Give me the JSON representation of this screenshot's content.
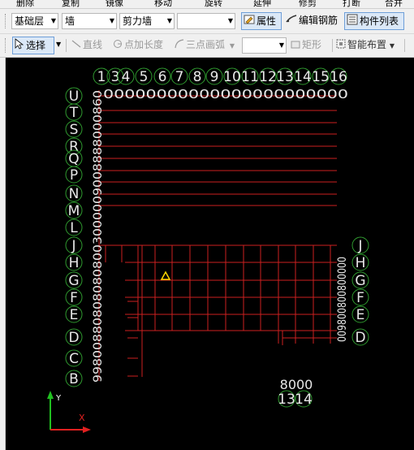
{
  "top_menu": [
    "删除",
    "复制",
    "镜像",
    "移动",
    "旋转",
    "延伸",
    "修剪",
    "打断",
    "合并"
  ],
  "toolbar1": {
    "floor": "基础层",
    "element_type": "墙",
    "element_subtype": "剪力墙",
    "property_label": "属性",
    "edit_rebar_label": "编辑钢筋",
    "component_list_label": "构件列表"
  },
  "toolbar2": {
    "select_label": "选择",
    "line_label": "直线",
    "point_length_label": "点加长度",
    "three_point_arc_label": "三点画弧",
    "rect_label": "矩形",
    "smart_layout_label": "智能布置"
  },
  "canvas": {
    "top_axes": [
      "1",
      "3",
      "4",
      "5",
      "6",
      "7",
      "8",
      "9",
      "10",
      "11",
      "12",
      "13",
      "14",
      "15",
      "16"
    ],
    "top_dimension_row": "00000000000000000000000",
    "left_axes": [
      "U",
      "T",
      "S",
      "R",
      "Q",
      "P",
      "N",
      "M",
      "L",
      "J",
      "H",
      "G",
      "F",
      "E",
      "D",
      "C",
      "B"
    ],
    "left_dimension_column": "998008808080808003000009008888000860",
    "right_axes": [
      "J",
      "H",
      "G",
      "F",
      "E",
      "D"
    ],
    "right_dimension_column": "009800800800000",
    "bottom_dimension": "8000",
    "bottom_axes": [
      "13",
      "14"
    ],
    "colors": {
      "background": "#000000",
      "grid_lines": "#cc2020",
      "axis_bubble": "#2f9a2f",
      "axis_text": "#e8e8e8",
      "marker": "#ffd700",
      "x_axis": "#e02020",
      "y_axis": "#20c020"
    },
    "axis_x_label": "X",
    "axis_y_label": "Y"
  }
}
